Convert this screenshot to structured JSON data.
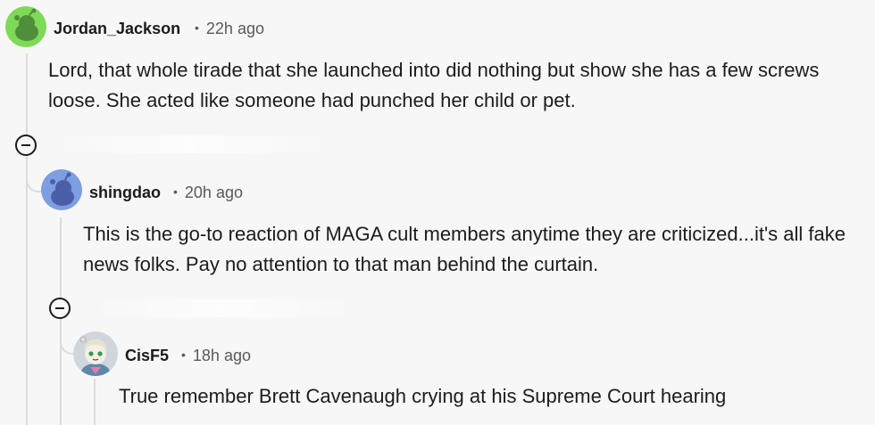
{
  "comments": [
    {
      "username": "Jordan_Jackson",
      "time": "22h ago",
      "body": "Lord, that whole tirade that she launched into did nothing but show she has a few screws loose. She acted like someone had punched her child or pet.",
      "avatar_color": "#7ed957"
    },
    {
      "username": "shingdao",
      "time": "20h ago",
      "body": "This is the go-to reaction of MAGA cult members anytime they are criticized...it's all fake news folks. Pay no attention to that man behind the curtain.",
      "avatar_color": "#7d9ee0"
    },
    {
      "username": "CisF5",
      "time": "18h ago",
      "body": "True remember Brett Cavenaugh crying at his Supreme Court hearing",
      "avatar_color": "#cfd6dc"
    }
  ],
  "separator": "•",
  "icons": {
    "collapse": "collapse-icon",
    "avatar": "snoo-avatar-icon"
  },
  "colors": {
    "background": "#f7f7f7",
    "thread_line": "#dcdcdc",
    "text": "#1c1c1c",
    "meta": "#595959"
  }
}
